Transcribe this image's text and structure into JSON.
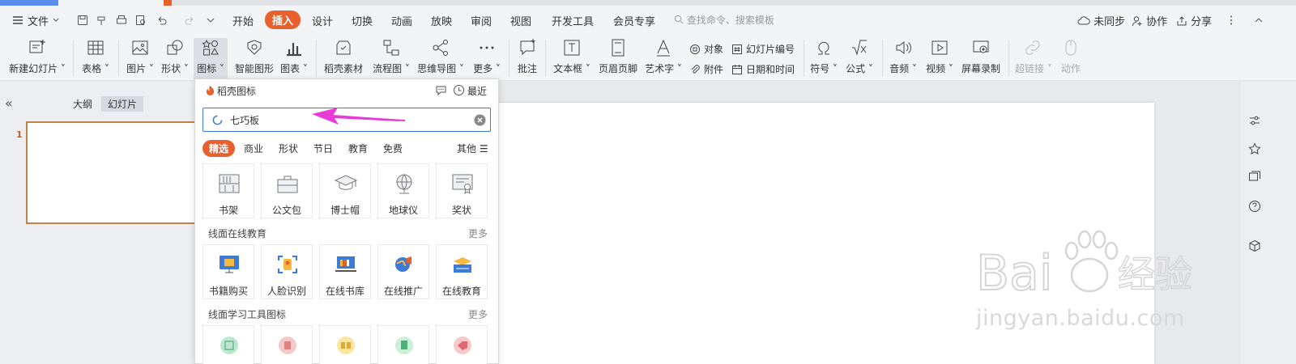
{
  "menu": {
    "file": "文件",
    "tabs": [
      "开始",
      "插入",
      "设计",
      "切换",
      "动画",
      "放映",
      "审阅",
      "视图",
      "开发工具",
      "会员专享"
    ],
    "active_tab": "插入",
    "search_placeholder": "查找命令、搜索模板",
    "right": [
      "未同步",
      "协作",
      "分享"
    ]
  },
  "ribbon": {
    "new_slide": "新建幻灯片",
    "table": "表格",
    "picture": "图片",
    "shape": "形状",
    "icon": "图标",
    "smart_art": "智能图形",
    "chart": "图表",
    "docer_material": "稻壳素材",
    "flowchart": "流程图",
    "mindmap": "思维导图",
    "more": "更多",
    "comment": "批注",
    "textbox": "文本框",
    "header_footer": "页眉页脚",
    "wordart": "艺术字",
    "object": "对象",
    "attachment": "附件",
    "slide_number": "幻灯片编号",
    "datetime": "日期和时间",
    "symbol": "符号",
    "formula": "公式",
    "audio": "音频",
    "video": "视频",
    "screen_record": "屏幕录制",
    "hyperlink": "超链接",
    "action": "动作"
  },
  "left_panel": {
    "tabs": [
      "大纲",
      "幻灯片"
    ],
    "selected_tab": "幻灯片",
    "slide_number": "1"
  },
  "icon_panel": {
    "title": "稻壳图标",
    "recent": "最近",
    "search_value": "七巧板",
    "categories": [
      "精选",
      "商业",
      "形状",
      "节日",
      "教育",
      "免费"
    ],
    "selected_category": "精选",
    "other": "其他",
    "row1": [
      "书架",
      "公文包",
      "博士帽",
      "地球仪",
      "奖状"
    ],
    "section2_title": "线面在线教育",
    "section2_more": "更多",
    "row2": [
      "书籍购买",
      "人脸识别",
      "在线书库",
      "在线推广",
      "在线教育"
    ],
    "section3_title": "线面学习工具图标",
    "section3_more": "更多"
  },
  "watermark": {
    "brand": "Bai 经验",
    "url": "jingyan.baidu.com"
  },
  "colors": {
    "accent": "#e8602c",
    "arrow": "#e83ad6",
    "search_border": "#3b7ad9"
  }
}
